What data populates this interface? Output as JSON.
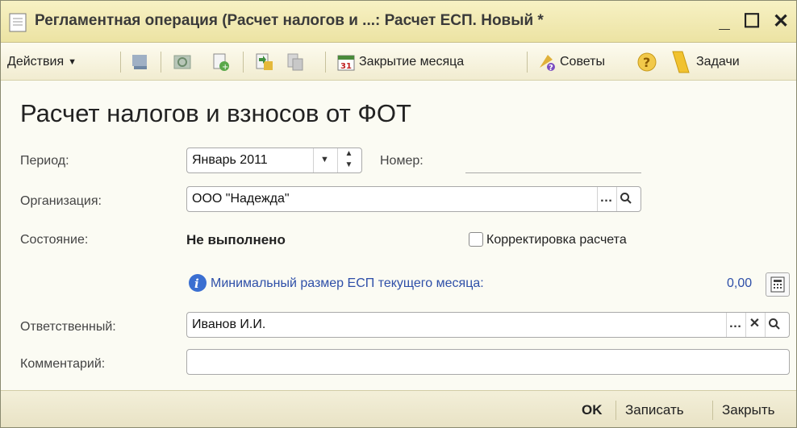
{
  "window": {
    "title": "Регламентная операция (Расчет налогов и ...: Расчет ЕСП. Новый *",
    "minimize": "_",
    "maximize": "☐",
    "close": "✕"
  },
  "toolbar": {
    "actions_label": "Действия",
    "month_close_label": "Закрытие месяца",
    "tips_label": "Советы",
    "help_glyph": "?",
    "tasks_label": "Задачи"
  },
  "form": {
    "heading": "Расчет налогов и взносов от ФОТ",
    "period_label": "Период:",
    "period_value": "Январь 2011",
    "number_label": "Номер:",
    "number_value": "",
    "organization_label": "Организация:",
    "organization_value": "ООО \"Надежда\"",
    "state_label": "Состояние:",
    "state_value": "Не выполнено",
    "correction_label": "Корректировка расчета",
    "correction_checked": false,
    "min_esp_label": "Минимальный размер ЕСП текущего месяца:",
    "min_esp_value": "0,00",
    "responsible_label": "Ответственный:",
    "responsible_value": "Иванов И.И.",
    "comment_label": "Комментарий:",
    "comment_value": ""
  },
  "footer": {
    "ok_label": "OK",
    "save_label": "Записать",
    "close_label": "Закрыть"
  },
  "colors": {
    "title_bar": "#ece3a3",
    "link": "#2e4fa8",
    "window_bg": "#fbfbf3"
  }
}
